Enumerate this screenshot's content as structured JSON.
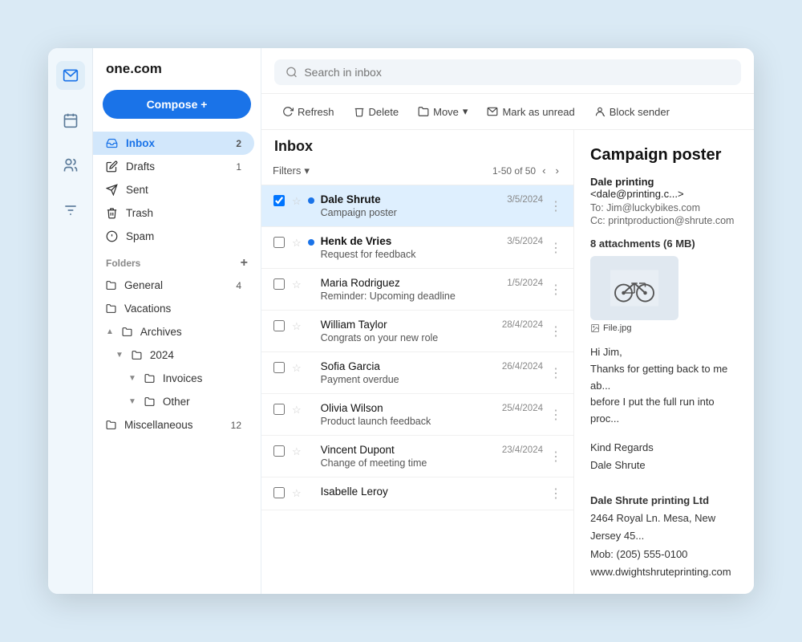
{
  "app": {
    "logo": "one.com",
    "compose_label": "Compose +"
  },
  "icon_bar": {
    "items": [
      {
        "name": "mail-icon",
        "symbol": "✉",
        "active": true
      },
      {
        "name": "calendar-icon",
        "symbol": "📅",
        "active": false
      },
      {
        "name": "contacts-icon",
        "symbol": "👥",
        "active": false
      },
      {
        "name": "settings-icon",
        "symbol": "⚙",
        "active": false
      }
    ]
  },
  "sidebar": {
    "items": [
      {
        "id": "inbox",
        "label": "Inbox",
        "badge": "2",
        "active": true
      },
      {
        "id": "drafts",
        "label": "Drafts",
        "badge": "1",
        "active": false
      },
      {
        "id": "sent",
        "label": "Sent",
        "badge": "",
        "active": false
      },
      {
        "id": "trash",
        "label": "Trash",
        "badge": "",
        "active": false
      },
      {
        "id": "spam",
        "label": "Spam",
        "badge": "",
        "active": false
      }
    ],
    "folders_label": "Folders",
    "folder_items": [
      {
        "id": "general",
        "label": "General",
        "badge": "4",
        "indent": 0
      },
      {
        "id": "vacations",
        "label": "Vacations",
        "badge": "",
        "indent": 0
      },
      {
        "id": "archives",
        "label": "Archives",
        "badge": "",
        "indent": 0
      },
      {
        "id": "2024",
        "label": "2024",
        "badge": "",
        "indent": 1
      },
      {
        "id": "invoices",
        "label": "Invoices",
        "badge": "",
        "indent": 2
      },
      {
        "id": "other",
        "label": "Other",
        "badge": "",
        "indent": 2
      },
      {
        "id": "miscellaneous",
        "label": "Miscellaneous",
        "badge": "12",
        "indent": 0
      }
    ]
  },
  "search": {
    "placeholder": "Search in inbox"
  },
  "toolbar": {
    "refresh_label": "Refresh",
    "delete_label": "Delete",
    "move_label": "Move",
    "mark_unread_label": "Mark as unread",
    "block_sender_label": "Block sender"
  },
  "inbox": {
    "title": "Inbox",
    "filter_label": "Filters",
    "pagination": "1-50 of 50",
    "emails": [
      {
        "id": 1,
        "sender": "Dale Shrute",
        "subject": "Campaign poster",
        "date": "3/5/2024",
        "unread": true,
        "selected": true
      },
      {
        "id": 2,
        "sender": "Henk de Vries",
        "subject": "Request for feedback",
        "date": "3/5/2024",
        "unread": true,
        "selected": false
      },
      {
        "id": 3,
        "sender": "Maria Rodriguez",
        "subject": "Reminder: Upcoming deadline",
        "date": "1/5/2024",
        "unread": false,
        "selected": false
      },
      {
        "id": 4,
        "sender": "William Taylor",
        "subject": "Congrats on your new role",
        "date": "28/4/2024",
        "unread": false,
        "selected": false
      },
      {
        "id": 5,
        "sender": "Sofia Garcia",
        "subject": "Payment overdue",
        "date": "26/4/2024",
        "unread": false,
        "selected": false
      },
      {
        "id": 6,
        "sender": "Olivia Wilson",
        "subject": "Product launch feedback",
        "date": "25/4/2024",
        "unread": false,
        "selected": false
      },
      {
        "id": 7,
        "sender": "Vincent Dupont",
        "subject": "Change of meeting time",
        "date": "23/4/2024",
        "unread": false,
        "selected": false
      },
      {
        "id": 8,
        "sender": "Isabelle Leroy",
        "subject": "",
        "date": "",
        "unread": false,
        "selected": false
      }
    ]
  },
  "email_detail": {
    "title": "Campaign poster",
    "from_name": "Dale printing",
    "from_email": "<dale@printing.c...>",
    "to": "To: Jim@luckybikes.com",
    "cc": "Cc: printproduction@shrute.com",
    "attachments_label": "8 attachments (6 MB)",
    "attachment_filename": "File.jpg",
    "body_lines": [
      "Hi Jim,",
      "Thanks for getting back to me ab...",
      "before I put the full run into proc..."
    ],
    "regards": "Kind Regards",
    "regards_name": "Dale Shrute",
    "signature_company": "Dale Shrute printing Ltd",
    "signature_address": "2464 Royal Ln. Mesa, New Jersey 45...",
    "signature_mob": "Mob: (205) 555-0100",
    "signature_web": "www.dwightshruteprinting.com"
  }
}
